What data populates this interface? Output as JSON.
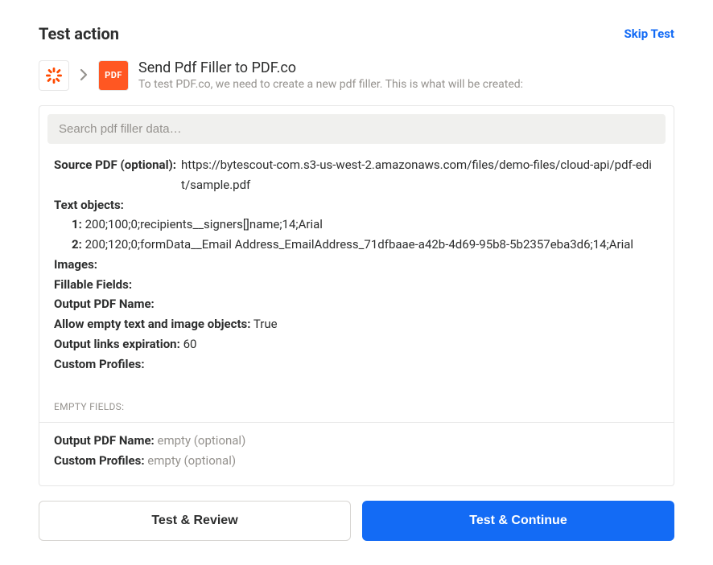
{
  "header": {
    "title": "Test action",
    "skip_label": "Skip Test"
  },
  "apps": {
    "source_icon_name": "zapier-icon",
    "target_icon_name": "pdfco-icon",
    "target_icon_text": "PDF",
    "action_title": "Send Pdf Filler to PDF.co",
    "action_subtitle": "To test PDF.co, we need to create a new pdf filler. This is what will be created:"
  },
  "search": {
    "placeholder": "Search pdf filler data…"
  },
  "fields": {
    "source_pdf_label": "Source PDF (optional):",
    "source_pdf_value": "https://bytescout-com.s3-us-west-2.amazonaws.com/files/demo-files/cloud-api/pdf-edit/sample.pdf",
    "text_objects_label": "Text objects:",
    "text_objects": [
      {
        "idx": "1:",
        "value": "200;100;0;recipients__signers[]name;14;Arial"
      },
      {
        "idx": "2:",
        "value": "200;120;0;formData__Email Address_EmailAddress_71dfbaae-a42b-4d69-95b8-5b2357eba3d6;14;Arial"
      }
    ],
    "images_label": "Images:",
    "fillable_fields_label": "Fillable Fields:",
    "output_pdf_name_label": "Output PDF Name:",
    "allow_empty_label": "Allow empty text and image objects:",
    "allow_empty_value": "True",
    "output_links_label": "Output links expiration:",
    "output_links_value": "60",
    "custom_profiles_label": "Custom Profiles:"
  },
  "empty_section": {
    "header": "EMPTY FIELDS:",
    "rows": [
      {
        "label": "Output PDF Name:",
        "value": "empty (optional)"
      },
      {
        "label": "Custom Profiles:",
        "value": "empty (optional)"
      }
    ]
  },
  "buttons": {
    "review": "Test & Review",
    "continue": "Test & Continue"
  }
}
